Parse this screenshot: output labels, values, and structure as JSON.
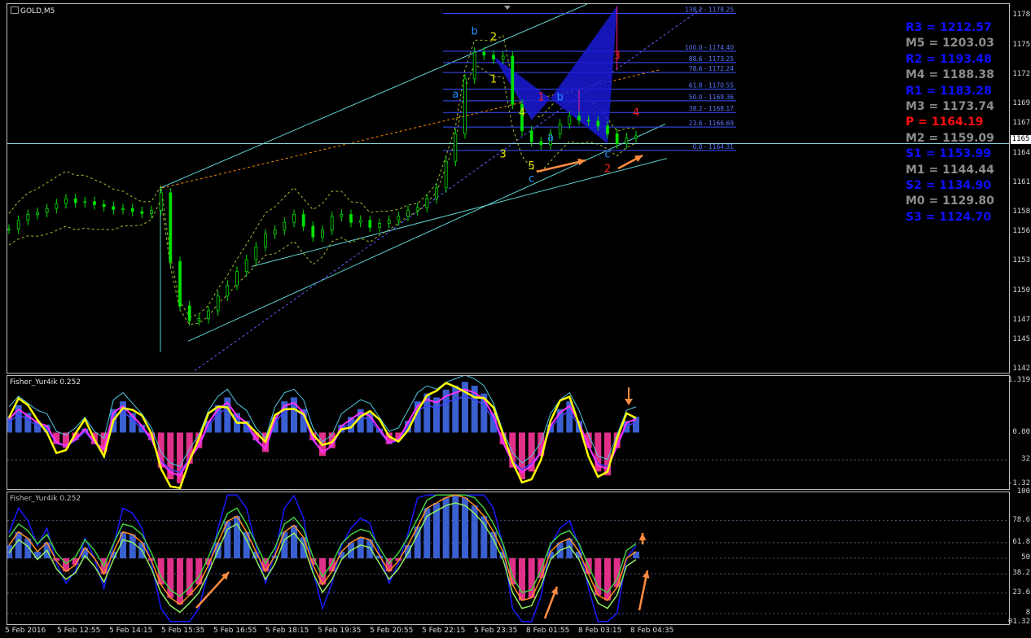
{
  "main_title": "GOLD,M5",
  "ind1_title": "Fisher_Yur4ik 0.252",
  "ind2_title": "Fisher_Yur4ik 0.252",
  "current_price_tag": "1165",
  "pivots": [
    {
      "label": "R3 = 1212.57",
      "color": "#1010ff"
    },
    {
      "label": "M5 = 1203.03",
      "color": "#8c8c8c"
    },
    {
      "label": "R2 = 1193.48",
      "color": "#1010ff"
    },
    {
      "label": "M4 = 1188.38",
      "color": "#8c8c8c"
    },
    {
      "label": "R1 = 1183.28",
      "color": "#1010ff"
    },
    {
      "label": "M3 = 1173.74",
      "color": "#8c8c8c"
    },
    {
      "label": "P  = 1164.19",
      "color": "#ff1010"
    },
    {
      "label": "M2 = 1159.09",
      "color": "#8c8c8c"
    },
    {
      "label": "S1 = 1153.99",
      "color": "#1010ff"
    },
    {
      "label": "M1 = 1144.44",
      "color": "#8c8c8c"
    },
    {
      "label": "S2 = 1134.90",
      "color": "#1010ff"
    },
    {
      "label": "M0 = 1129.80",
      "color": "#8c8c8c"
    },
    {
      "label": "S3 = 1124.70",
      "color": "#1010ff"
    }
  ],
  "fib_levels": [
    {
      "label": "138.2 - 1178.25",
      "value": 1178.25
    },
    {
      "label": "100.0 - 1174.40",
      "value": 1174.4
    },
    {
      "label": "88.6 - 1173.25",
      "value": 1173.25
    },
    {
      "label": "78.6 - 1172.24",
      "value": 1172.24
    },
    {
      "label": "61.8 - 1170.55",
      "value": 1170.55
    },
    {
      "label": "50.0 - 1169.36",
      "value": 1169.36
    },
    {
      "label": "38.2 - 1168.17",
      "value": 1168.17
    },
    {
      "label": "23.6 - 1166.69",
      "value": 1166.69
    },
    {
      "label": "0.0 - 1164.31",
      "value": 1164.31
    }
  ],
  "wave_labels": [
    {
      "text": "b",
      "color": "#1e90ff",
      "x": 49,
      "y": 1176.1
    },
    {
      "text": "2",
      "color": "#e6e600",
      "x": 51,
      "y": 1175.5
    },
    {
      "text": "1",
      "color": "#e6e600",
      "x": 51,
      "y": 1171.2
    },
    {
      "text": "a",
      "color": "#1e90ff",
      "x": 47,
      "y": 1169.7
    },
    {
      "text": "4",
      "color": "#e6e600",
      "x": 54,
      "y": 1167.8
    },
    {
      "text": "1",
      "color": "#ff2020",
      "x": 56,
      "y": 1169.4
    },
    {
      "text": "b",
      "color": "#1e90ff",
      "x": 58,
      "y": 1169.4
    },
    {
      "text": "a",
      "color": "#1e90ff",
      "x": 57,
      "y": 1165.3
    },
    {
      "text": "3",
      "color": "#e6e600",
      "x": 52,
      "y": 1163.6
    },
    {
      "text": "5",
      "color": "#e6e600",
      "x": 55,
      "y": 1162.4
    },
    {
      "text": "c",
      "color": "#1e90ff",
      "x": 55,
      "y": 1161.1
    },
    {
      "text": "3",
      "color": "#ff2020",
      "x": 64,
      "y": 1173.6
    },
    {
      "text": "4",
      "color": "#ff2020",
      "x": 66,
      "y": 1167.8
    },
    {
      "text": "c",
      "color": "#1e90ff",
      "x": 63,
      "y": 1163.6
    },
    {
      "text": "2",
      "color": "#ff2020",
      "x": 63,
      "y": 1162.1
    }
  ],
  "chart_data": [
    {
      "type": "line",
      "title": "GOLD,M5",
      "x": [
        "5 Feb 2016",
        "5 Feb 12:55",
        "5 Feb 14:15",
        "5 Feb 15:35",
        "5 Feb 16:55",
        "5 Feb 18:15",
        "5 Feb 19:35",
        "5 Feb 20:55",
        "5 Feb 22:15",
        "5 Feb 23:35",
        "8 Feb 01:55",
        "8 Feb 03:15",
        "8 Feb 04:35"
      ],
      "y_ticks": [
        1178,
        1175,
        1172,
        1169,
        1167,
        1164,
        1161,
        1158,
        1156,
        1153,
        1150,
        1147,
        1145,
        1142
      ],
      "ylim": [
        1141.7,
        1179.2
      ],
      "series": [
        {
          "values": [
            1156.3,
            1157.2,
            1157.8,
            1158.0,
            1158.4,
            1158.9,
            1159.4,
            1159.0,
            1159.1,
            1158.8,
            1158.6,
            1158.3,
            1158.4,
            1158.1,
            1157.9,
            1158.2,
            1160.0,
            1153.0,
            1148.5,
            1147.0,
            1147.2,
            1148.0,
            1149.5,
            1150.6,
            1152.0,
            1153.2,
            1154.5,
            1155.8,
            1156.2,
            1157.0,
            1157.8,
            1156.6,
            1155.5,
            1156.2,
            1157.6,
            1157.8,
            1157.0,
            1157.2,
            1156.5,
            1156.9,
            1157.2,
            1157.6,
            1158.2,
            1158.5,
            1159.4,
            1160.5,
            1163.2,
            1166.0,
            1171.6,
            1174.3,
            1174.0,
            1173.6,
            1173.9,
            1169.0,
            1166.3,
            1165.2,
            1164.9,
            1166.0,
            1167.0,
            1167.8,
            1167.4,
            1167.3,
            1166.8,
            1166.0,
            1165.0,
            1165.6,
            1165.8
          ]
        }
      ]
    },
    {
      "type": "bar",
      "title": "Fisher_Yur4ik 0.252",
      "y_ticks": [
        "1.319",
        "0.00",
        "32",
        "-1.32"
      ],
      "ylim": [
        -1.45,
        1.45
      ],
      "series": [
        {
          "values": [
            0.4,
            0.7,
            0.5,
            0.3,
            0.2,
            -0.3,
            -0.4,
            -0.2,
            0.1,
            -0.3,
            -0.5,
            0.6,
            0.8,
            0.5,
            0.2,
            -0.2,
            -0.9,
            -1.2,
            -1.3,
            -0.8,
            -0.4,
            0.3,
            0.7,
            0.9,
            0.5,
            0.3,
            -0.2,
            -0.5,
            0.4,
            0.8,
            0.9,
            0.6,
            -0.2,
            -0.6,
            -0.4,
            0.2,
            0.4,
            0.6,
            0.5,
            0.1,
            -0.3,
            -0.2,
            0.3,
            0.8,
            1.0,
            0.9,
            1.1,
            1.2,
            1.3,
            1.2,
            1.0,
            0.5,
            -0.3,
            -0.9,
            -1.2,
            -1.0,
            -0.6,
            0.2,
            0.6,
            0.8,
            0.3,
            -0.4,
            -1.0,
            -1.1,
            -0.4,
            0.3,
            0.4
          ]
        }
      ]
    },
    {
      "type": "bar",
      "title": "Fisher_Yur4ik 0.252",
      "y_ticks": [
        "100",
        "78.6",
        "61.8",
        "50",
        "38.2",
        "23.6",
        "8",
        "01.32"
      ],
      "ylim": [
        0,
        100
      ],
      "series": [
        {
          "values": [
            60,
            70,
            65,
            55,
            62,
            48,
            40,
            45,
            58,
            50,
            38,
            55,
            70,
            68,
            62,
            48,
            30,
            20,
            15,
            22,
            30,
            45,
            62,
            78,
            82,
            70,
            55,
            40,
            52,
            70,
            75,
            66,
            45,
            30,
            40,
            55,
            62,
            66,
            64,
            52,
            40,
            48,
            60,
            74,
            88,
            92,
            96,
            98,
            96,
            90,
            82,
            70,
            55,
            30,
            18,
            20,
            35,
            55,
            62,
            65,
            55,
            38,
            22,
            18,
            28,
            50,
            55
          ]
        }
      ]
    }
  ]
}
